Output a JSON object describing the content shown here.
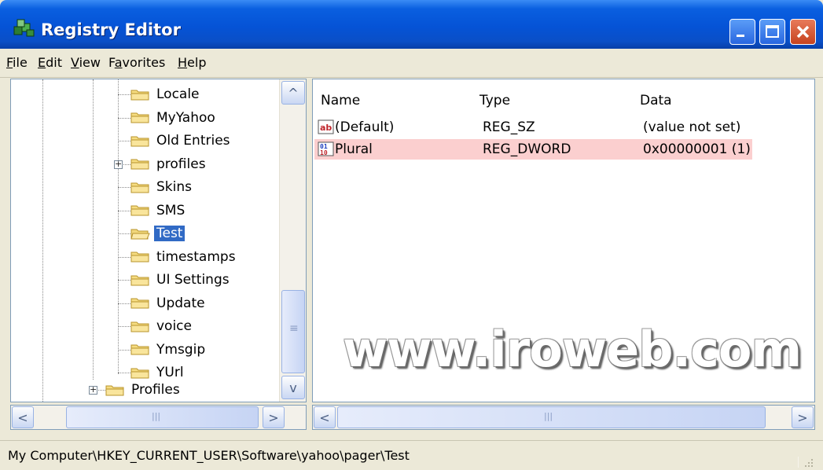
{
  "window": {
    "title": "Registry Editor",
    "title_icon": "registry-cubes-icon"
  },
  "menu": {
    "file": {
      "accel": "F",
      "rest": "ile"
    },
    "edit": {
      "accel": "E",
      "rest": "dit"
    },
    "view": {
      "accel": "V",
      "rest": "iew"
    },
    "favorites": {
      "pre": "F",
      "accel": "a",
      "rest": "vorites"
    },
    "help": {
      "accel": "H",
      "rest": "elp"
    }
  },
  "tree": {
    "items": [
      {
        "label": "Locale"
      },
      {
        "label": "MyYahoo"
      },
      {
        "label": "Old Entries"
      },
      {
        "label": "profiles",
        "expandable": true
      },
      {
        "label": "Skins"
      },
      {
        "label": "SMS"
      },
      {
        "label": "Test",
        "selected": true
      },
      {
        "label": "timestamps"
      },
      {
        "label": "UI Settings"
      },
      {
        "label": "Update"
      },
      {
        "label": "voice"
      },
      {
        "label": "Ymsgip"
      },
      {
        "label": "YUrl"
      },
      {
        "label": "Profiles",
        "expandable": true
      }
    ],
    "expander_symbol": "+"
  },
  "list": {
    "columns": [
      "Name",
      "Type",
      "Data"
    ],
    "rows": [
      {
        "name": "(Default)",
        "type": "REG_SZ",
        "data": "(value not set)",
        "icon": "string-value-icon"
      },
      {
        "name": "Plural",
        "type": "REG_DWORD",
        "data": "0x00000001 (1)",
        "icon": "binary-value-icon",
        "highlight_color": "#fbcfcf"
      }
    ]
  },
  "watermark": "www.iroweb.com",
  "status": {
    "path": "My Computer\\HKEY_CURRENT_USER\\Software\\yahoo\\pager\\Test"
  },
  "scroll": {
    "up": "^",
    "down": "v",
    "left": "<",
    "right": ">",
    "grip": "|||",
    "thumb_grip": "≡"
  }
}
